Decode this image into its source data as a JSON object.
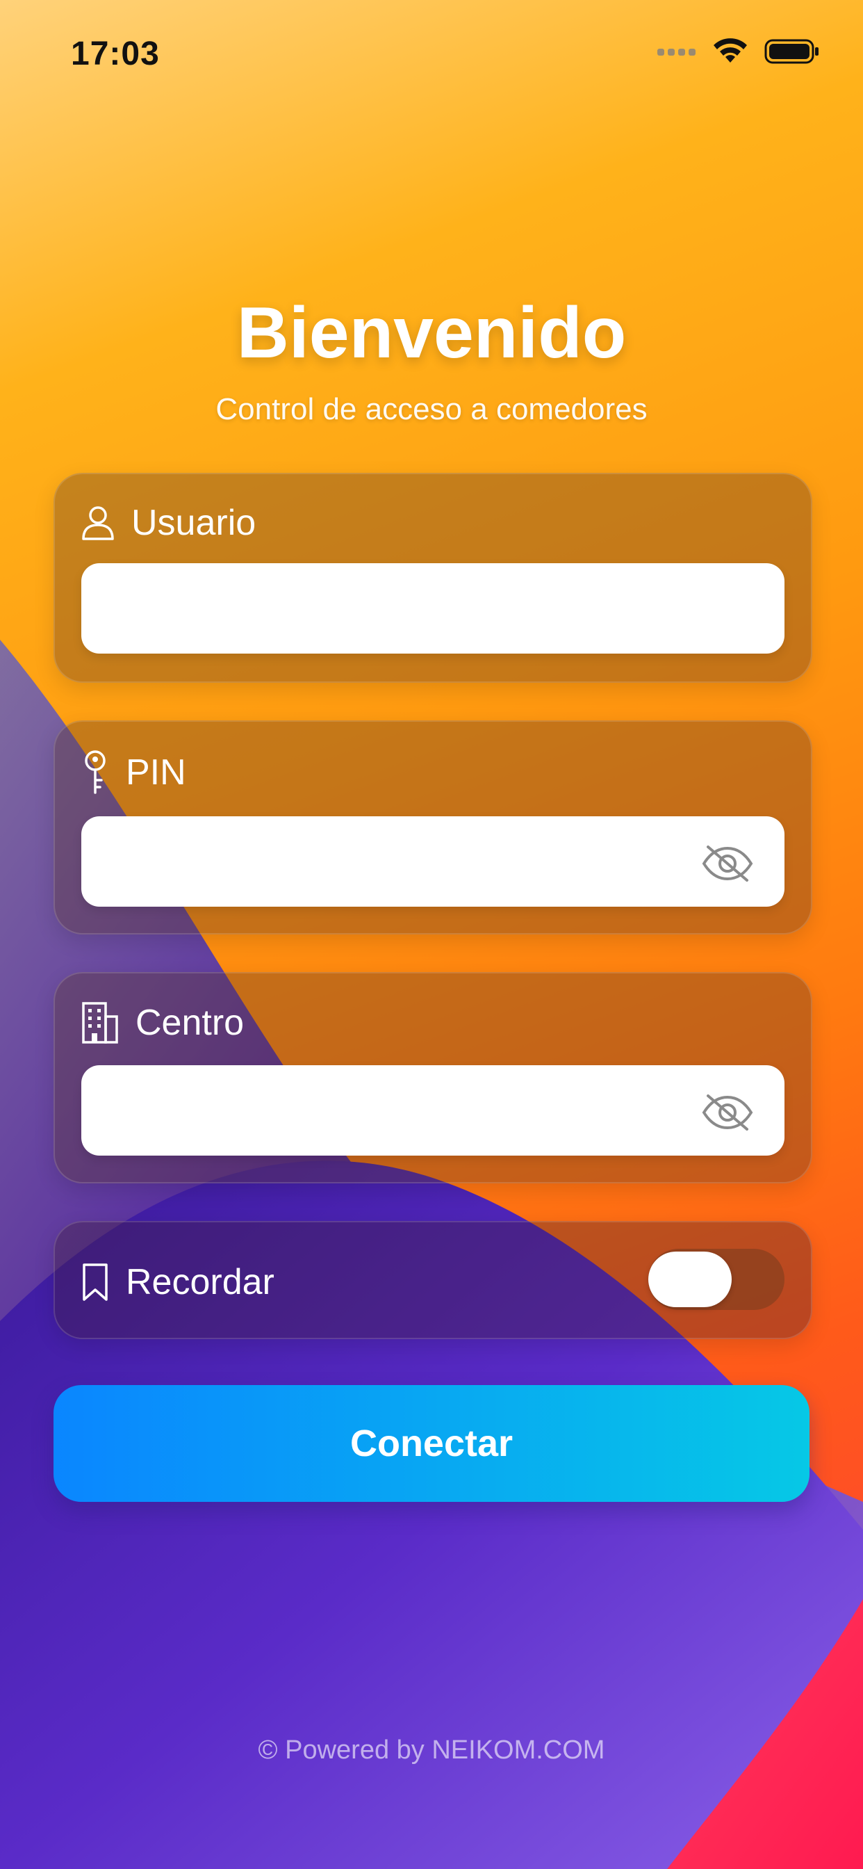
{
  "status": {
    "time": "17:03"
  },
  "header": {
    "title": "Bienvenido",
    "subtitle": "Control de acceso a comedores"
  },
  "form": {
    "usuario": {
      "label": "Usuario",
      "value": ""
    },
    "pin": {
      "label": "PIN",
      "value": ""
    },
    "centro": {
      "label": "Centro",
      "value": ""
    },
    "remember": {
      "label": "Recordar",
      "enabled": false
    }
  },
  "actions": {
    "connect_label": "Conectar"
  },
  "footer": {
    "text": "© Powered by NEIKOM.COM"
  },
  "colors": {
    "accent_start": "#0a86ff",
    "accent_end": "#06c8e6",
    "background_top": "#ffb21a",
    "background_purple": "#5a2bc8"
  },
  "icons": {
    "usuario": "person-icon",
    "pin": "key-icon",
    "centro": "building-icon",
    "remember": "bookmark-icon",
    "visibility": "eye-slash-icon"
  }
}
